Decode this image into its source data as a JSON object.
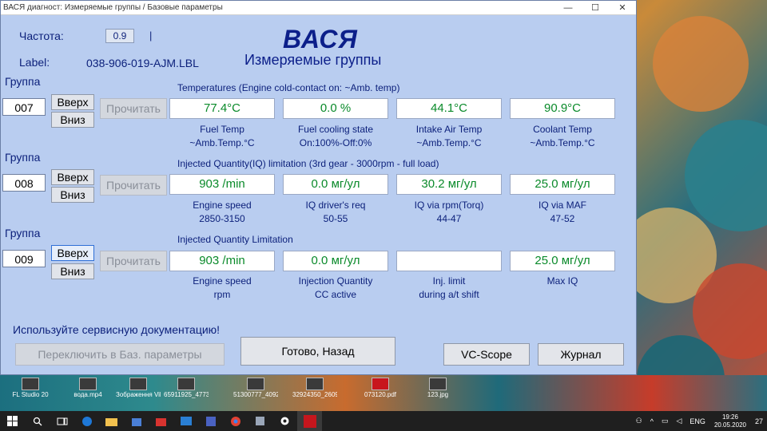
{
  "window": {
    "title": "ВАСЯ диагност: Измеряемые группы / Базовые параметры",
    "ctrl_minimize": "—",
    "ctrl_maximize": "☐",
    "ctrl_close": "✕"
  },
  "header": {
    "freq_label": "Частота:",
    "freq_value": "0.9",
    "freq_caret": "|",
    "label_label": "Label:",
    "label_value": "038-906-019-AJM.LBL",
    "brand": "ВАСЯ",
    "subtitle": "Измеряемые группы"
  },
  "groups": [
    {
      "group_label": "Группа",
      "number": "007",
      "up": "Вверх",
      "down": "Вниз",
      "read": "Прочитать",
      "title": "Temperatures (Engine cold-contact on: ~Amb. temp)",
      "cells": [
        {
          "value": "77.4°C",
          "cap1": "Fuel Temp",
          "cap2": "~Amb.Temp.°C"
        },
        {
          "value": "0.0 %",
          "cap1": "Fuel cooling state",
          "cap2": "On:100%-Off:0%"
        },
        {
          "value": "44.1°C",
          "cap1": "Intake Air Temp",
          "cap2": "~Amb.Temp.°C"
        },
        {
          "value": "90.9°C",
          "cap1": "Coolant Temp",
          "cap2": "~Amb.Temp.°C"
        }
      ]
    },
    {
      "group_label": "Группа",
      "number": "008",
      "up": "Вверх",
      "down": "Вниз",
      "read": "Прочитать",
      "title": "Injected Quantity(IQ) limitation (3rd gear - 3000rpm - full load)",
      "cells": [
        {
          "value": "903 /min",
          "cap1": "Engine speed",
          "cap2": "2850-3150"
        },
        {
          "value": "0.0 мг/ул",
          "cap1": "IQ driver's req",
          "cap2": "50-55"
        },
        {
          "value": "30.2 мг/ул",
          "cap1": "IQ via rpm(Torq)",
          "cap2": "44-47"
        },
        {
          "value": "25.0 мг/ул",
          "cap1": "IQ via MAF",
          "cap2": "47-52"
        }
      ]
    },
    {
      "group_label": "Группа",
      "number": "009",
      "up": "Вверх",
      "down": "Вниз",
      "read": "Прочитать",
      "title": "Injected Quantity Limitation",
      "cells": [
        {
          "value": "903 /min",
          "cap1": "Engine speed",
          "cap2": "rpm"
        },
        {
          "value": "0.0 мг/ул",
          "cap1": "Injection Quantity",
          "cap2": "CC active"
        },
        {
          "value": "",
          "cap1": "Inj. limit",
          "cap2": "during a/t shift"
        },
        {
          "value": "25.0 мг/ул",
          "cap1": "Max IQ",
          "cap2": ""
        }
      ]
    }
  ],
  "footer": {
    "hint": "Используйте сервисную документацию!",
    "switch_btn": "Переключить в Баз. параметры",
    "done_btn": "Готово, Назад",
    "scope_btn": "VC-Scope",
    "log_btn": "Журнал"
  },
  "desktop_icons": [
    "FL Studio 20",
    "вода.mp4",
    "Зображення Viber...",
    "65911925_47735...",
    "51300777_40925...",
    "32924350_2609579...",
    "073120.pdf",
    "123.jpg"
  ],
  "taskbar": {
    "lang": "ENG",
    "time": "19:26",
    "date": "20.05.2020",
    "notif": "27"
  },
  "colors": {
    "window_bg": "#b9cdf0",
    "value_green": "#0a8a2a",
    "label_blue": "#0b1f7a"
  }
}
